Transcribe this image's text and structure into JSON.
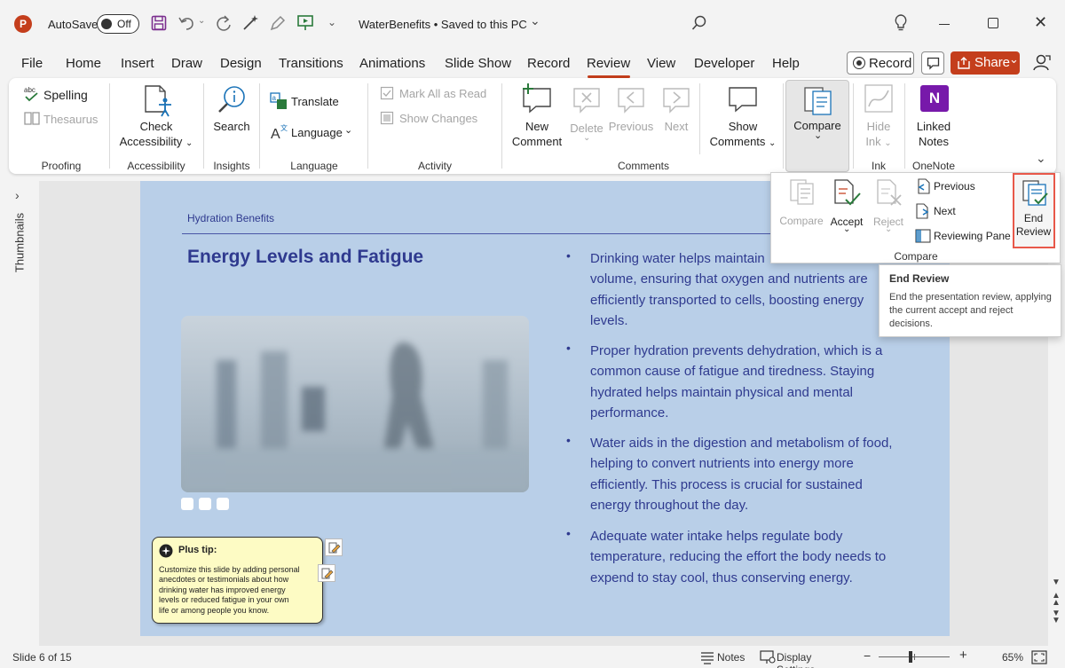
{
  "titlebar": {
    "autosave_label": "AutoSave",
    "autosave_state": "Off",
    "document_title": "WaterBenefits • Saved to this PC"
  },
  "menu": {
    "tabs": [
      "File",
      "Home",
      "Insert",
      "Draw",
      "Design",
      "Transitions",
      "Animations",
      "Slide Show",
      "Record",
      "Review",
      "View",
      "Developer",
      "Help"
    ],
    "active_tab": "Review",
    "record_button": "Record",
    "share_button": "Share"
  },
  "ribbon": {
    "proofing": {
      "label": "Proofing",
      "spelling": "Spelling",
      "thesaurus": "Thesaurus"
    },
    "accessibility": {
      "label": "Accessibility",
      "check_line1": "Check",
      "check_line2": "Accessibility"
    },
    "insights": {
      "label": "Insights",
      "search": "Search"
    },
    "language": {
      "label": "Language",
      "translate": "Translate",
      "language": "Language"
    },
    "activity": {
      "label": "Activity",
      "mark_all": "Mark All as Read",
      "show_changes": "Show Changes"
    },
    "comments": {
      "label": "Comments",
      "new_line1": "New",
      "new_line2": "Comment",
      "delete": "Delete",
      "previous": "Previous",
      "next": "Next",
      "show_line1": "Show",
      "show_line2": "Comments"
    },
    "compare": {
      "label": "Compare"
    },
    "ink": {
      "label": "Ink",
      "hide_line1": "Hide",
      "hide_line2": "Ink"
    },
    "onenote": {
      "label": "OneNote",
      "linked_line1": "Linked",
      "linked_line2": "Notes"
    }
  },
  "compare_panel": {
    "compare": "Compare",
    "accept": "Accept",
    "reject": "Reject",
    "previous": "Previous",
    "next": "Next",
    "reviewing_pane": "Reviewing Pane",
    "end_line1": "End",
    "end_line2": "Review",
    "group_label": "Compare"
  },
  "tooltip": {
    "title": "End Review",
    "body": "End the presentation review, applying the current accept and reject decisions."
  },
  "left_pane": {
    "label": "Thumbnails"
  },
  "slide": {
    "kicker": "Hydration Benefits",
    "title": "Energy Levels and Fatigue",
    "bullets": [
      {
        "lines": [
          "Drinking water helps maintain",
          "volume, ensuring that oxygen and nutrients are",
          "efficiently transported to cells, boosting energy",
          "levels."
        ]
      },
      {
        "lines": [
          "Proper hydration prevents dehydration, which is a",
          "common cause of fatigue and tiredness. Staying",
          "hydrated helps maintain physical and mental",
          "performance."
        ]
      },
      {
        "lines": [
          "Water aids in the digestion and metabolism of food,",
          "helping to convert nutrients into energy more",
          "efficiently. This process is crucial for sustained",
          "energy throughout the day."
        ]
      },
      {
        "lines": [
          "Adequate water intake helps regulate body",
          "temperature, reducing the effort the body needs to",
          "expend to stay cool, thus conserving energy."
        ]
      }
    ],
    "tip": {
      "title": "Plus tip:",
      "lines": [
        "Customize this slide by adding personal",
        "anecdotes or testimonials about how",
        "drinking water has improved energy",
        "levels or reduced fatigue in your own",
        "life or among people you know."
      ]
    }
  },
  "statusbar": {
    "slide_info": "Slide 6 of 15",
    "notes": "Notes",
    "display_settings": "Display Settings",
    "zoom": "65%"
  },
  "colors": {
    "accent": "#c43e1c",
    "slide_bg": "#b9cfe8",
    "slide_text": "#2f3a8f",
    "highlight_box": "#e8584a",
    "tip_bg": "#fdfbc4"
  }
}
